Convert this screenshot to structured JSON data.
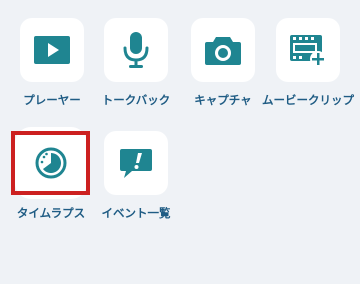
{
  "colors": {
    "background": "#eff2f6",
    "tile": "#ffffff",
    "icon": "#1f8591",
    "label": "#1f5c84",
    "selection": "#cc2020"
  },
  "apps": [
    {
      "label": "プレーヤー",
      "icon": "play-icon"
    },
    {
      "label": "トークバック",
      "icon": "microphone-icon"
    },
    {
      "label": "キャプチャ",
      "icon": "camera-icon"
    },
    {
      "label": "ムービークリップ",
      "icon": "film-add-icon"
    },
    {
      "label": "タイムラプス",
      "icon": "timelapse-timer-icon",
      "selected": true
    },
    {
      "label": "イベント一覧",
      "icon": "event-alert-icon"
    }
  ]
}
